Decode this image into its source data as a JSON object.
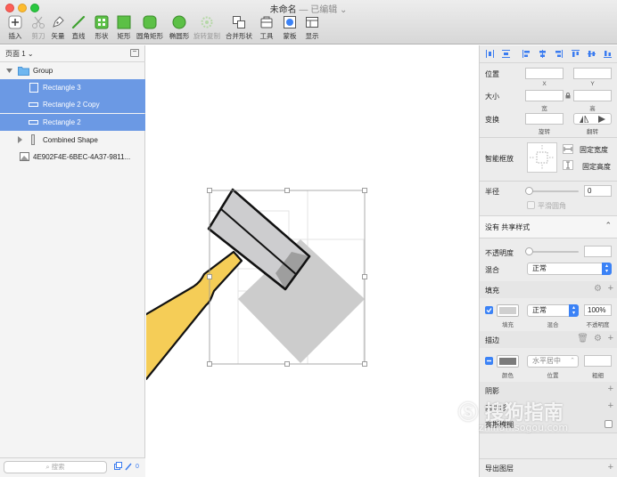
{
  "window": {
    "title": "未命名",
    "subtitle": "— 已编辑 ⌄"
  },
  "toolbar": {
    "items": [
      {
        "label": "插入",
        "icon": "plus-icon"
      },
      {
        "label": "剪刀",
        "icon": "scissors-icon"
      },
      {
        "label": "矢量",
        "icon": "pen-icon"
      },
      {
        "label": "直线",
        "icon": "line-icon"
      },
      {
        "label": "形状",
        "icon": "shapes-icon"
      },
      {
        "label": "矩形",
        "icon": "rectangle-icon"
      },
      {
        "label": "圆角矩形",
        "icon": "rounded-rectangle-icon"
      },
      {
        "label": "椭圆形",
        "icon": "oval-icon"
      },
      {
        "label": "旋转复制",
        "icon": "rotate-copy-icon"
      },
      {
        "label": "合并形状",
        "icon": "combine-icon"
      },
      {
        "label": "工具",
        "icon": "tools-icon"
      },
      {
        "label": "蒙板",
        "icon": "mask-icon"
      },
      {
        "label": "显示",
        "icon": "view-icon"
      }
    ]
  },
  "layers": {
    "page_label": "页面 1 ⌄",
    "items": [
      {
        "name": "Group",
        "type": "folder"
      },
      {
        "name": "Rectangle 3",
        "type": "rect"
      },
      {
        "name": "Rectangle 2 Copy",
        "type": "line"
      },
      {
        "name": "Rectangle 2",
        "type": "line"
      },
      {
        "name": "Combined Shape",
        "type": "combined"
      },
      {
        "name": "4E902F4E-6BEC-4A37-9811...",
        "type": "image"
      }
    ],
    "search_placeholder": "搜索",
    "footer_count": "0"
  },
  "inspector": {
    "position_label": "位置",
    "x_label": "X",
    "y_label": "Y",
    "size_label": "大小",
    "width_label": "宽",
    "height_label": "高",
    "transform_label": "变换",
    "rotate_label": "旋转",
    "flip_label": "翻转",
    "smart_resize_label": "智能框放",
    "fixed_width_label": "固定宽度",
    "fixed_height_label": "固定高度",
    "radius_label": "半径",
    "radius_value": "0",
    "smooth_corners_label": "平滑圆角",
    "shared_style": "没有 共享样式",
    "opacity_label": "不透明度",
    "blend_label": "混合",
    "blend_value": "正常",
    "fill": {
      "title": "填充",
      "blend_value": "正常",
      "opacity_value": "100%",
      "fill_caption": "填充",
      "blend_caption": "混合",
      "opacity_caption": "不透明度",
      "color": "#cfcfcf"
    },
    "border": {
      "title": "描边",
      "position_value": "水平居中",
      "color_caption": "颜色",
      "position_caption": "位置",
      "thickness_caption": "粗细",
      "color": "#7b7b7b"
    },
    "shadow_label": "阴影",
    "inner_shadow_label": "内阴影",
    "blur_label": "高斯模糊",
    "export_label": "导出图层"
  },
  "watermark": {
    "brand": "搜狗指南",
    "url": "zhinan.sogou.com"
  },
  "colors": {
    "accent": "#3b82f6",
    "selection": "#6b99e4",
    "handle_fill": "#f5cd57",
    "hammer_head": "#cdcdcf",
    "shadow_diamond": "#cccccc"
  }
}
